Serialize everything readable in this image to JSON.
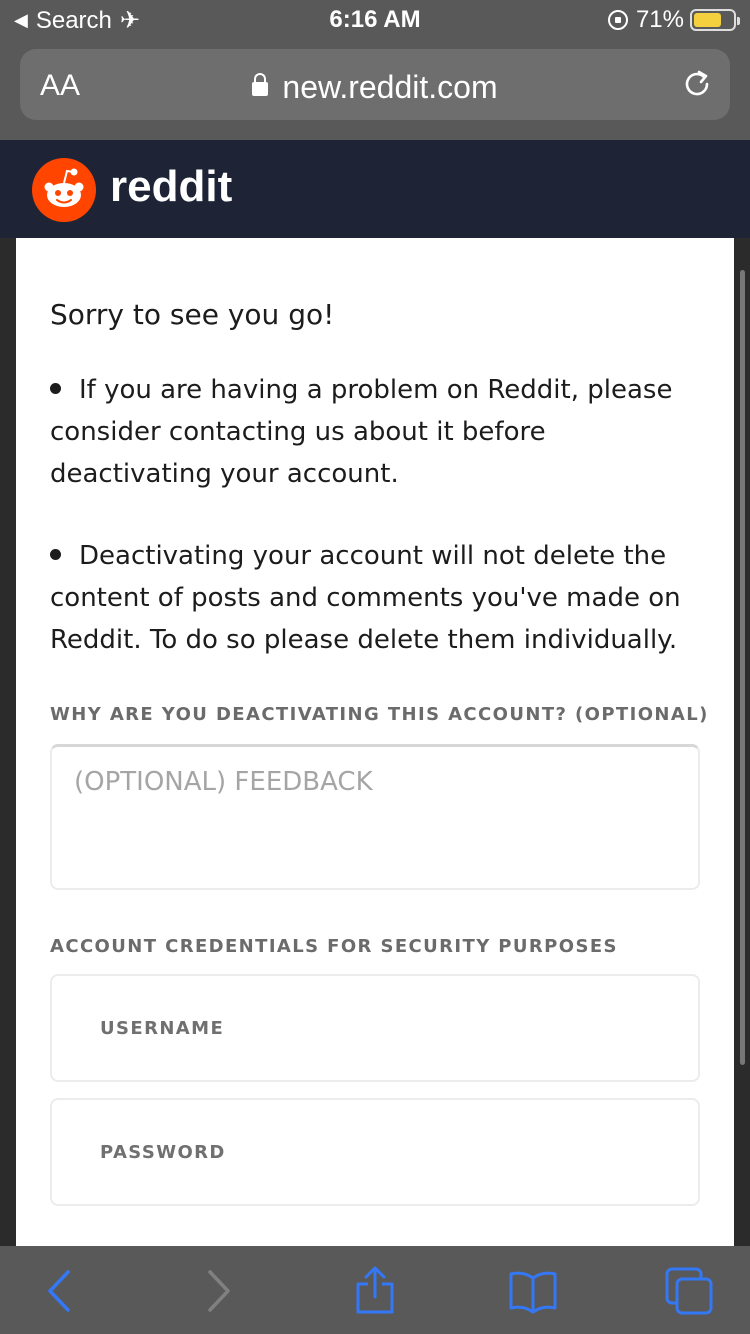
{
  "status_bar": {
    "back_label": "Search",
    "time": "6:16 AM",
    "battery_percent": "71%",
    "battery_level": 0.71
  },
  "browser": {
    "text_size_label": "AA",
    "url": "new.reddit.com"
  },
  "brand": {
    "name": "reddit",
    "accent": "#ff4500",
    "header_bg": "#1e2436"
  },
  "page": {
    "heading": "Sorry to see you go!",
    "bullets": [
      "If you are having a problem on Reddit, please consider contacting us about it before deactivating your account.",
      "Deactivating your account will not delete the content of posts and comments you've made on Reddit. To do so please delete them individually."
    ],
    "why_label": "WHY ARE YOU DEACTIVATING THIS ACCOUNT? (OPTIONAL)",
    "feedback_placeholder": "(OPTIONAL) FEEDBACK",
    "credentials_label": "ACCOUNT CREDENTIALS FOR SECURITY PURPOSES",
    "username_placeholder": "USERNAME",
    "password_placeholder": "PASSWORD"
  },
  "icons": {
    "back": "chevron-left-icon",
    "forward": "chevron-right-icon",
    "share": "share-icon",
    "bookmarks": "book-icon",
    "tabs": "tabs-icon",
    "reload": "reload-icon"
  }
}
